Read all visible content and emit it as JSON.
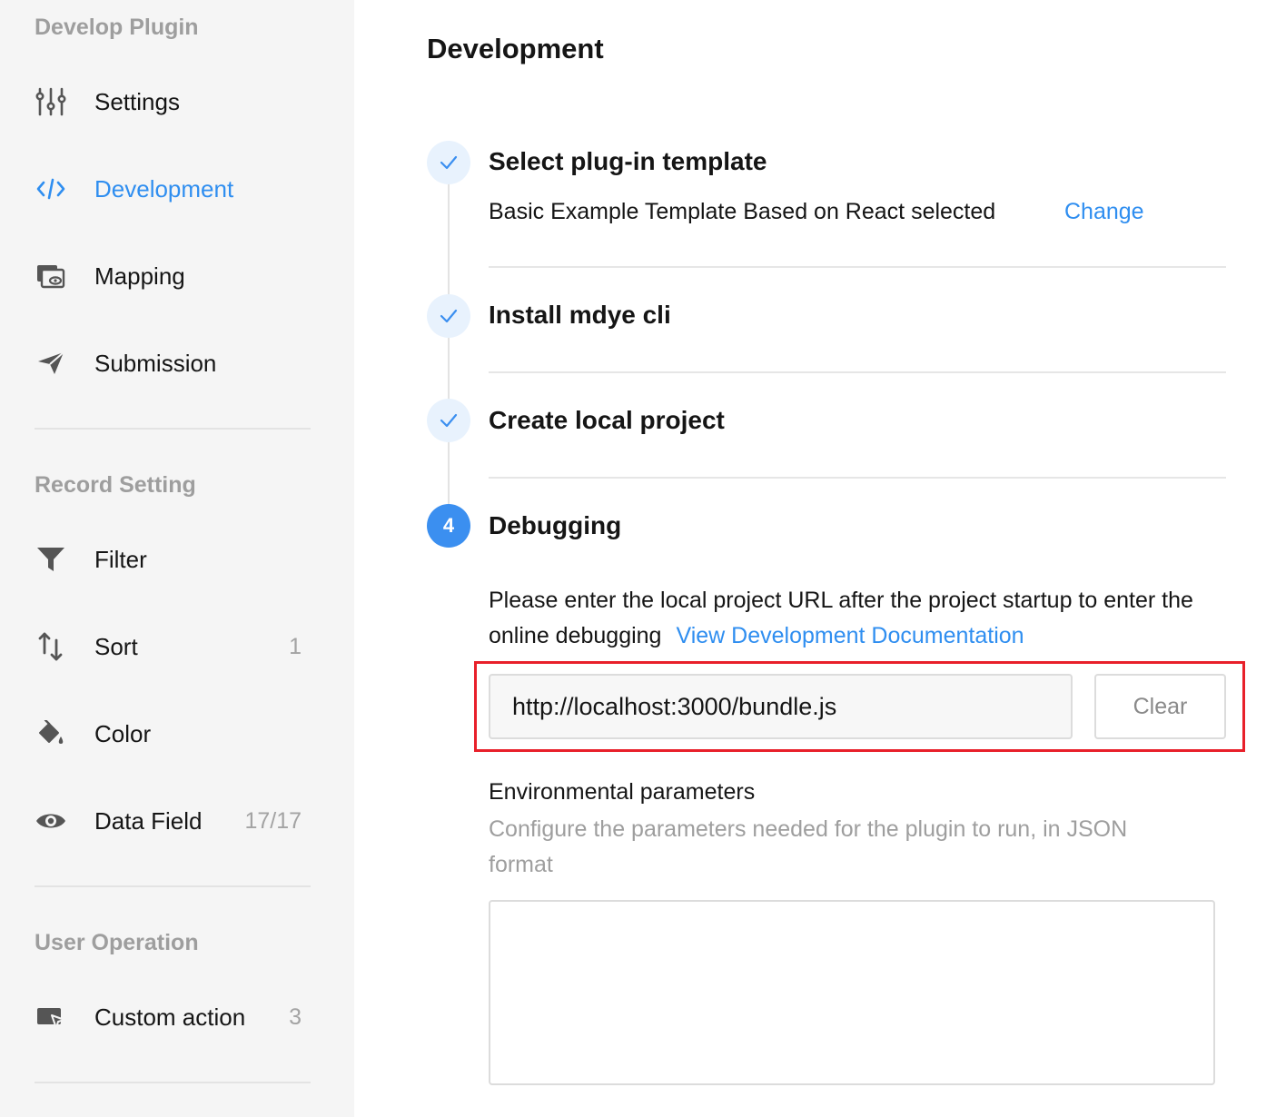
{
  "sidebar": {
    "sections": [
      {
        "title": "Develop Plugin",
        "items": [
          {
            "label": "Settings",
            "icon": "sliders-icon"
          },
          {
            "label": "Development",
            "icon": "code-icon",
            "active": true
          },
          {
            "label": "Mapping",
            "icon": "mapping-icon"
          },
          {
            "label": "Submission",
            "icon": "send-icon"
          }
        ]
      },
      {
        "title": "Record Setting",
        "items": [
          {
            "label": "Filter",
            "icon": "filter-icon"
          },
          {
            "label": "Sort",
            "icon": "sort-icon",
            "count": "1"
          },
          {
            "label": "Color",
            "icon": "paint-bucket-icon"
          },
          {
            "label": "Data Field",
            "icon": "eye-icon",
            "count": "17/17"
          }
        ]
      },
      {
        "title": "User Operation",
        "items": [
          {
            "label": "Custom action",
            "icon": "custom-action-icon",
            "count": "3"
          }
        ]
      }
    ]
  },
  "main": {
    "title": "Development",
    "steps": [
      {
        "title": "Select plug-in template",
        "status": "done",
        "description": "Basic Example Template Based on React selected",
        "action": "Change"
      },
      {
        "title": "Install mdye cli",
        "status": "done"
      },
      {
        "title": "Create local project",
        "status": "done"
      },
      {
        "title": "Debugging",
        "status": "current",
        "number": "4"
      }
    ],
    "debugging": {
      "description": "Please enter the local project URL after the project startup to enter the online debugging",
      "doc_link": "View Development Documentation",
      "url_value": "http://localhost:3000/bundle.js",
      "clear_label": "Clear",
      "env_title": "Environmental parameters",
      "env_description": "Configure the parameters needed for the plugin to run, in JSON format",
      "env_value": ""
    }
  },
  "colors": {
    "accent": "#2f8ef0",
    "highlight_border": "#e8202a",
    "sidebar_bg": "#f5f5f5",
    "muted_text": "#9e9e9e"
  }
}
